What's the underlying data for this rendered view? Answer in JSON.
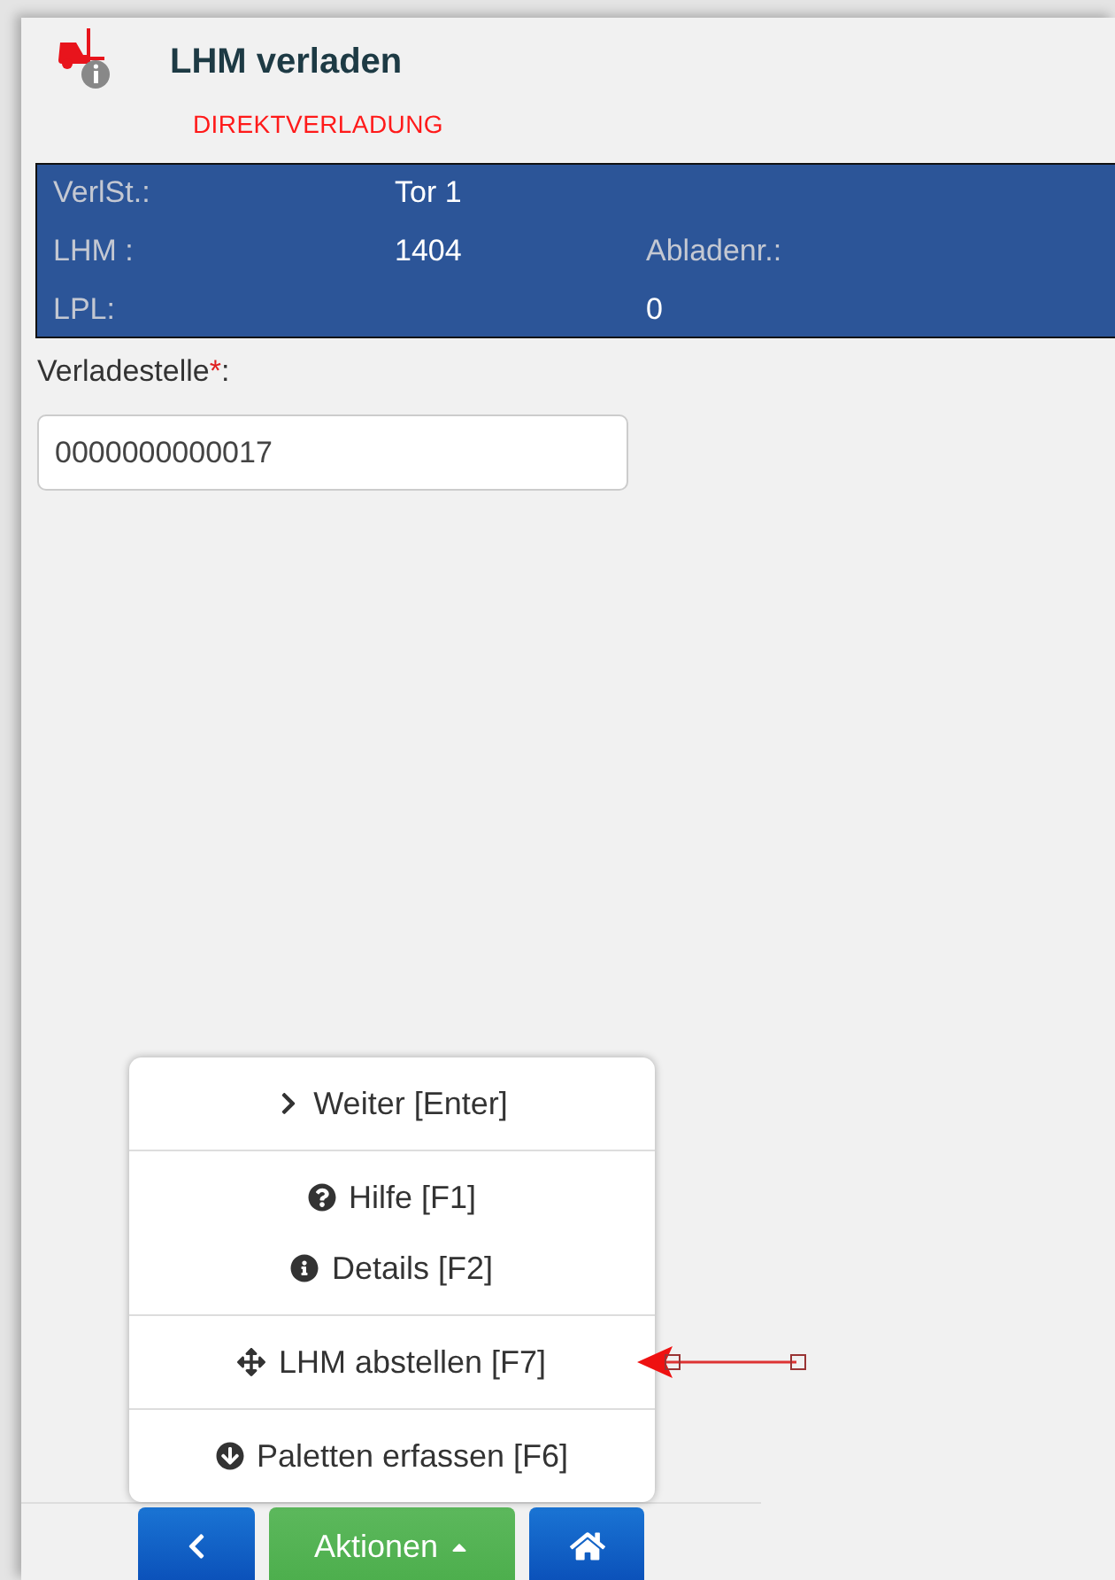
{
  "header": {
    "title": "LHM verladen",
    "subtitle": "DIREKTVERLADUNG"
  },
  "info_rows": [
    {
      "cells": [
        {
          "kind": "label",
          "text": "VerlSt.:"
        },
        {
          "kind": "value",
          "text": "Tor 1"
        }
      ]
    },
    {
      "cells": [
        {
          "kind": "label",
          "text": "LHM :"
        },
        {
          "kind": "value",
          "text": "1404"
        },
        {
          "kind": "label",
          "text": "Abladenr.:"
        }
      ]
    },
    {
      "cells": [
        {
          "kind": "label",
          "text": "LPL:"
        },
        {
          "kind": "gap"
        },
        {
          "kind": "value",
          "text": "0"
        }
      ]
    }
  ],
  "field": {
    "label": "Verladestelle",
    "required": true,
    "required_mark": "*",
    "label_suffix": ":",
    "value": "0000000000017"
  },
  "menu": {
    "sections": [
      {
        "items": [
          {
            "kind": "next",
            "label": "Weiter [Enter]"
          }
        ]
      },
      {
        "items": [
          {
            "kind": "help",
            "label": "Hilfe [F1]"
          },
          {
            "kind": "details",
            "label": "Details [F2]"
          }
        ]
      },
      {
        "items": [
          {
            "kind": "park",
            "label": "LHM abstellen [F7]"
          }
        ]
      },
      {
        "items": [
          {
            "kind": "pallets",
            "label": "Paletten erfassen [F6]"
          }
        ]
      }
    ]
  },
  "toolbar": [
    {
      "kind": "back"
    },
    {
      "kind": "menu",
      "label": "Aktionen",
      "expanded": true
    },
    {
      "kind": "home"
    }
  ]
}
